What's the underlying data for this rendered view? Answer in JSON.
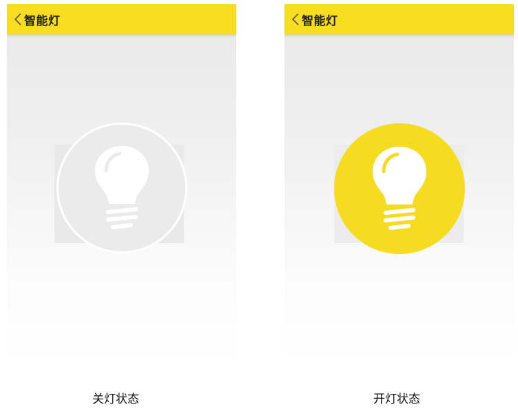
{
  "colors": {
    "accent_yellow": "#f7dc1f",
    "bulb_on_circle": "#f6dc21",
    "bulb_off_circle": "#ebebeb",
    "bulb_glyph": "#ffffff"
  },
  "screens": [
    {
      "state": "off",
      "header": {
        "back_icon": "chevron-left-icon",
        "title": "智能灯"
      },
      "bulb_icon": "light-bulb-icon",
      "caption": "关灯状态"
    },
    {
      "state": "on",
      "header": {
        "back_icon": "chevron-left-icon",
        "title": "智能灯"
      },
      "bulb_icon": "light-bulb-icon",
      "caption": "开灯状态"
    }
  ]
}
